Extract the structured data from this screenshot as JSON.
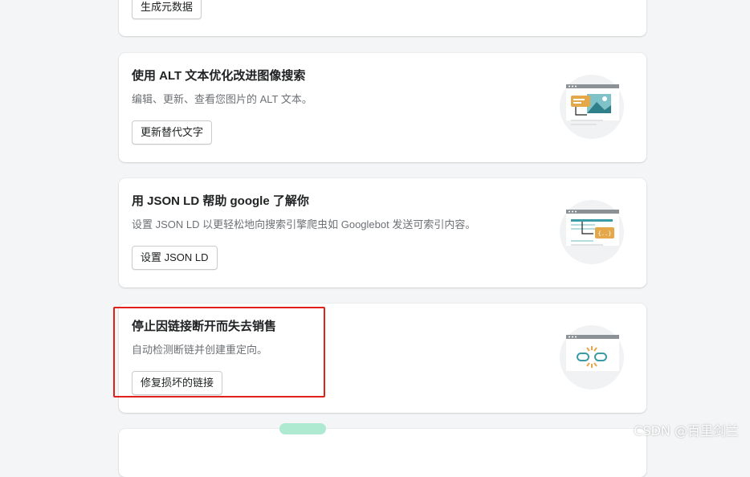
{
  "cards": [
    {
      "button": "生成元数据"
    },
    {
      "title": "使用 ALT 文本优化改进图像搜索",
      "desc": "编辑、更新、查看您图片的 ALT 文本。",
      "button": "更新替代文字"
    },
    {
      "title": "用 JSON LD 帮助 google 了解你",
      "desc": "设置 JSON LD 以更轻松地向搜索引擎爬虫如 Googlebot 发送可索引内容。",
      "button": "设置 JSON LD"
    },
    {
      "title": "停止因链接断开而失去销售",
      "desc": "自动检测断链并创建重定向。",
      "button": "修复损坏的链接"
    }
  ],
  "colors": {
    "highlight": "#e0201b",
    "illustration_bg": "#f1f2f3",
    "accent_orange": "#e4a84a",
    "accent_teal": "#3a9aa5"
  },
  "icons": [
    "image-seo-illustration",
    "json-ld-illustration",
    "broken-link-illustration"
  ],
  "watermark": "CSDN @百里剑兰"
}
